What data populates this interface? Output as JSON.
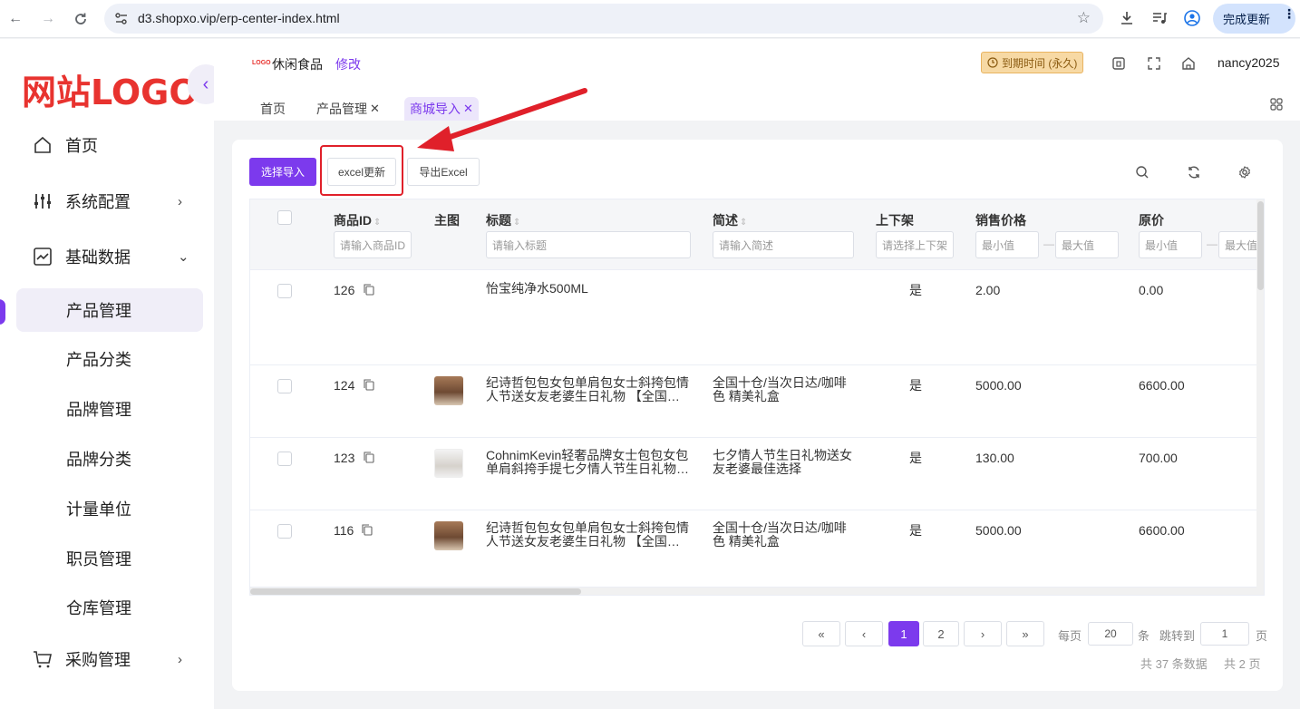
{
  "browser": {
    "url": "d3.shopxo.vip/erp-center-index.html",
    "update_label": "完成更新"
  },
  "sidebar": {
    "logo": "网站LOGO",
    "menu": [
      {
        "label": "首页"
      },
      {
        "label": "系统配置"
      },
      {
        "label": "基础数据"
      }
    ],
    "sub_items": [
      {
        "label": "产品管理"
      },
      {
        "label": "产品分类"
      },
      {
        "label": "品牌管理"
      },
      {
        "label": "品牌分类"
      },
      {
        "label": "计量单位"
      },
      {
        "label": "职员管理"
      },
      {
        "label": "仓库管理"
      }
    ],
    "purchase": {
      "label": "采购管理"
    }
  },
  "header": {
    "shop_logo": "LOGO",
    "shop_name": "休闲食品",
    "edit_label": "修改",
    "expire_label": "到期时间 (永久)",
    "username": "nancy2025"
  },
  "tabs": [
    {
      "label": "首页"
    },
    {
      "label": "产品管理"
    },
    {
      "label": "商城导入"
    }
  ],
  "toolbar": {
    "select_import": "选择导入",
    "excel_update": "excel更新",
    "export_excel": "导出Excel"
  },
  "table": {
    "columns": {
      "id": "商品ID",
      "image": "主图",
      "title": "标题",
      "brief": "简述",
      "shelf": "上下架",
      "price": "销售价格",
      "original_price": "原价"
    },
    "filters": {
      "id": "请输入商品ID",
      "title": "请输入标题",
      "brief": "请输入简述",
      "shelf": "请选择上下架",
      "min": "最小值",
      "max": "最大值"
    },
    "rows": [
      {
        "id": "126",
        "title": "怡宝纯净水500ML",
        "title2": "",
        "brief": "",
        "brief2": "",
        "shelf": "是",
        "price": "2.00",
        "original": "0.00"
      },
      {
        "id": "124",
        "title": "纪诗哲包包女包单肩包女士斜挎包情",
        "title2": "人节送女友老婆生日礼物 【全国…",
        "brief": "全国十仓/当次日达/咖啡",
        "brief2": "色 精美礼盒",
        "shelf": "是",
        "price": "5000.00",
        "original": "6600.00"
      },
      {
        "id": "123",
        "title": "CohnimKevin轻奢品牌女士包包女包",
        "title2": "单肩斜挎手提七夕情人节生日礼物…",
        "brief": "七夕情人节生日礼物送女",
        "brief2": "友老婆最佳选择",
        "shelf": "是",
        "price": "130.00",
        "original": "700.00"
      },
      {
        "id": "116",
        "title": "纪诗哲包包女包单肩包女士斜挎包情",
        "title2": "人节送女友老婆生日礼物 【全国…",
        "brief": "全国十仓/当次日达/咖啡",
        "brief2": "色 精美礼盒",
        "shelf": "是",
        "price": "5000.00",
        "original": "6600.00"
      }
    ]
  },
  "pagination": {
    "first": "«",
    "prev": "‹",
    "page1": "1",
    "page2": "2",
    "next": "›",
    "last": "»",
    "per_page_label": "每页",
    "per_page_value": "20",
    "unit": "条",
    "jump_label": "跳转到",
    "jump_value": "1",
    "page_unit": "页",
    "total_records": "共 37 条数据",
    "total_pages": "共 2 页"
  },
  "colors": {
    "accent": "#7c3aed",
    "logo_red": "#e8332f",
    "annotation_red": "#e0202a"
  }
}
